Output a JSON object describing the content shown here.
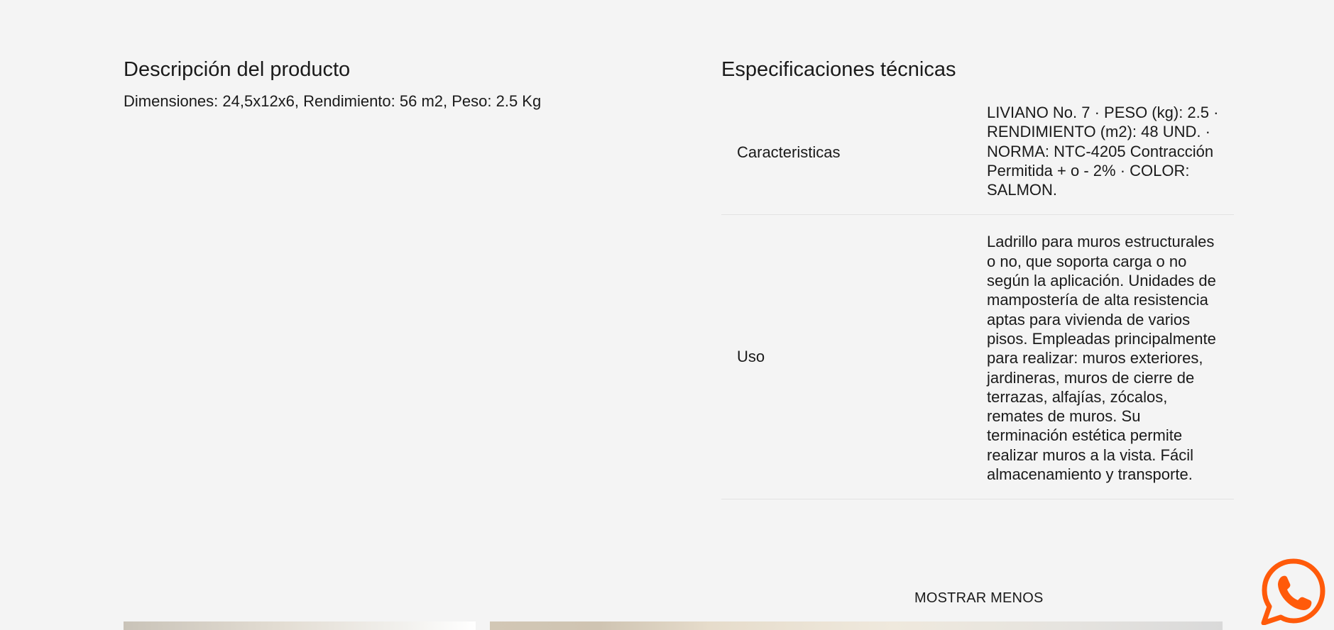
{
  "description": {
    "title": "Descripción del producto",
    "text": "Dimensiones: 24,5x12x6, Rendimiento: 56 m2, Peso: 2.5 Kg"
  },
  "specs": {
    "title": "Especificaciones técnicas",
    "rows": [
      {
        "name": "Caracteristicas",
        "value": "LIVIANO No. 7 · PESO (kg): 2.5 · RENDIMIENTO (m2): 48 UND. · NORMA: NTC-4205 Contracción Permitida + o - 2% · COLOR: SALMON."
      },
      {
        "name": "Uso",
        "value": "Ladrillo para muros estructurales o no, que soporta carga o no según la aplicación. Unidades de mampostería de alta resistencia aptas para vivienda de varios pisos. Empleadas principalmente para realizar: muros exteriores, jardineras, muros de cierre de terrazas, alfajías, zócalos, remates de muros. Su terminación estética permite realizar muros a la vista. Fácil almacenamiento y transporte."
      }
    ],
    "toggle_label": "MOSTRAR MENOS"
  },
  "whatsapp": {
    "icon": "whatsapp-icon",
    "color": "#ff5a0a"
  }
}
